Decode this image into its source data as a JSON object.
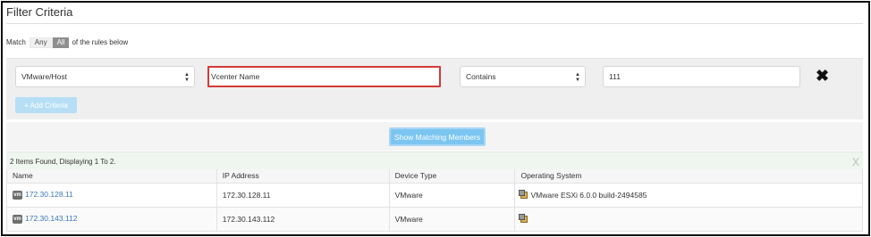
{
  "header": {
    "title": "Filter Criteria"
  },
  "match": {
    "prefix": "Match",
    "any_label": "Any",
    "all_label": "All",
    "suffix": "of the rules below",
    "selected": "All"
  },
  "criteria": {
    "attribute_value": "VMware/Host",
    "name_field_value": "Vcenter Name",
    "operator_value": "Contains",
    "value_field_value": "111",
    "delete_icon": "close-x-icon",
    "add_label": "+ Add Criteria"
  },
  "actions": {
    "show_label": "Show Matching Members"
  },
  "results": {
    "summary": "2 Items Found, Displaying 1 To 2.",
    "close_glyph": "X",
    "columns": [
      "Name",
      "IP Address",
      "Device Type",
      "Operating System"
    ],
    "rows": [
      {
        "badge": "vm",
        "name": "172.30.128.11",
        "ip": "172.30.128.11",
        "device_type": "VMware",
        "os": "VMware ESXi 6.0.0 build-2494585"
      },
      {
        "badge": "vm",
        "name": "172.30.143.112",
        "ip": "172.30.143.112",
        "device_type": "VMware",
        "os": ""
      }
    ]
  },
  "colors": {
    "accent_blue": "#7cc5f1",
    "error_border": "#d23a3a",
    "link": "#3a78b8"
  }
}
